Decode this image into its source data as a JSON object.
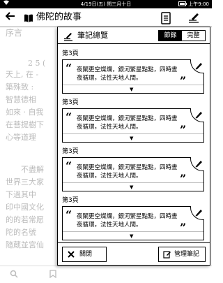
{
  "status_bar": {
    "center": "4/19日(五) 閏三月十日",
    "right": "上午9:00"
  },
  "title_bar": {
    "title": "佛陀的故事"
  },
  "reader_lines": [
    "序言",
    "2 5 (",
    "天上, 在 -",
    "築殊致 :",
    "智慧德相",
    "如來 · 自我",
    "在菩提樹下",
    "心等道理",
    "不盡解",
    "世界三大家",
    "下過其中",
    "印中國文化",
    "的的若常愿",
    "陀的名號",
    "隨蔵並宮仙"
  ],
  "panel": {
    "title": "筆記總覽",
    "tabs": [
      {
        "label": "節錄",
        "active": true
      },
      {
        "label": "完整",
        "active": false
      }
    ],
    "notes": [
      {
        "page": "第3頁",
        "text": "夜闌更空燦爛，銀河繁星點點，四時晝夜循環，法性天地人間。"
      },
      {
        "page": "第3頁",
        "text": "夜闌更空燦爛，銀河繁星點點，四時晝夜循環，法性天地人間。"
      },
      {
        "page": "第3頁",
        "text": "夜闌更空燦爛，銀河繁星點點，四時晝夜循環，法性天地人間。"
      },
      {
        "page": "第3頁",
        "text": "夜闌更空燦爛，銀河繁星點點，四時晝夜循環，法性天地人間。"
      }
    ],
    "close_label": "關閉",
    "manage_label": "管理筆記"
  },
  "icons": {
    "back": "back-arrow-icon",
    "book": "book-icon",
    "toc": "toc-icon",
    "notes": "notes-pen-icon",
    "edit": "pencil-icon",
    "caret": "caret-down-icon",
    "close": "x-icon",
    "manage": "edit-note-icon"
  }
}
